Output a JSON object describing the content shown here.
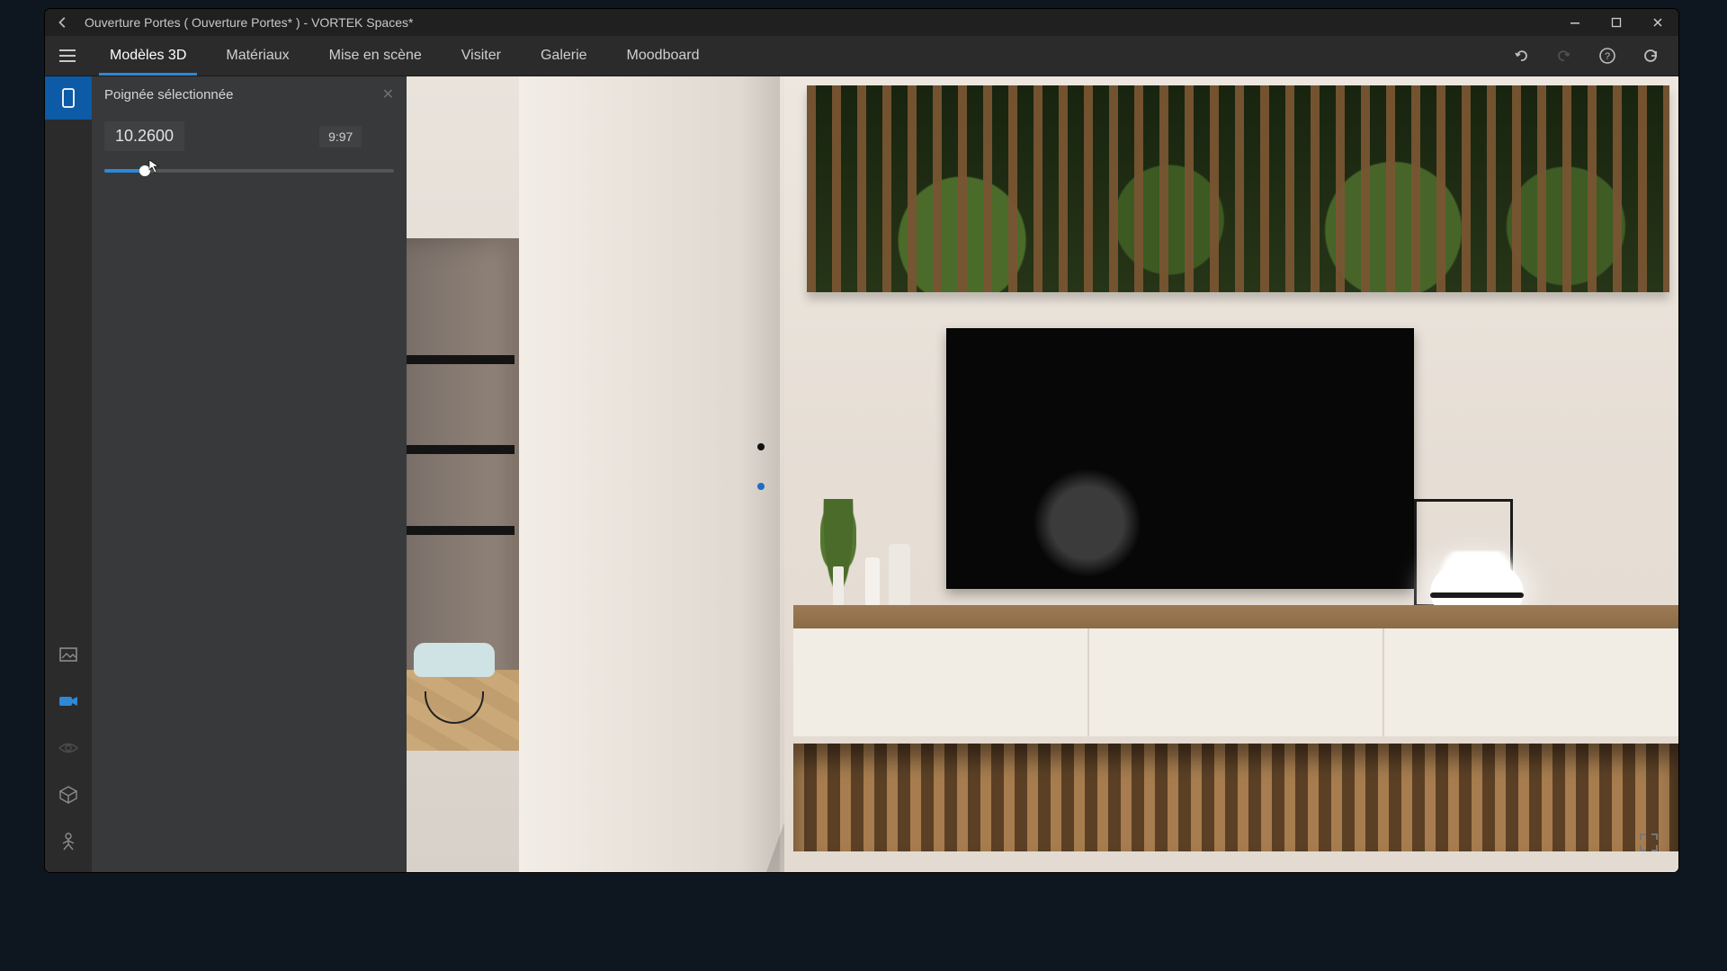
{
  "titlebar": {
    "title": "Ouverture Portes ( Ouverture Portes* ) - VORTEK Spaces*"
  },
  "tabs": {
    "items": [
      {
        "label": "Modèles 3D"
      },
      {
        "label": "Matériaux"
      },
      {
        "label": "Mise en scène"
      },
      {
        "label": "Visiter"
      },
      {
        "label": "Galerie"
      },
      {
        "label": "Moodboard"
      }
    ],
    "active_index": 0
  },
  "panel": {
    "title": "Poignée sélectionnée",
    "value": "10.2600",
    "timecode": "9:97",
    "slider_percent": 14
  },
  "colors": {
    "accent": "#2e88d6",
    "window_bg": "#2b2b2b",
    "panel_bg": "#37393a"
  }
}
